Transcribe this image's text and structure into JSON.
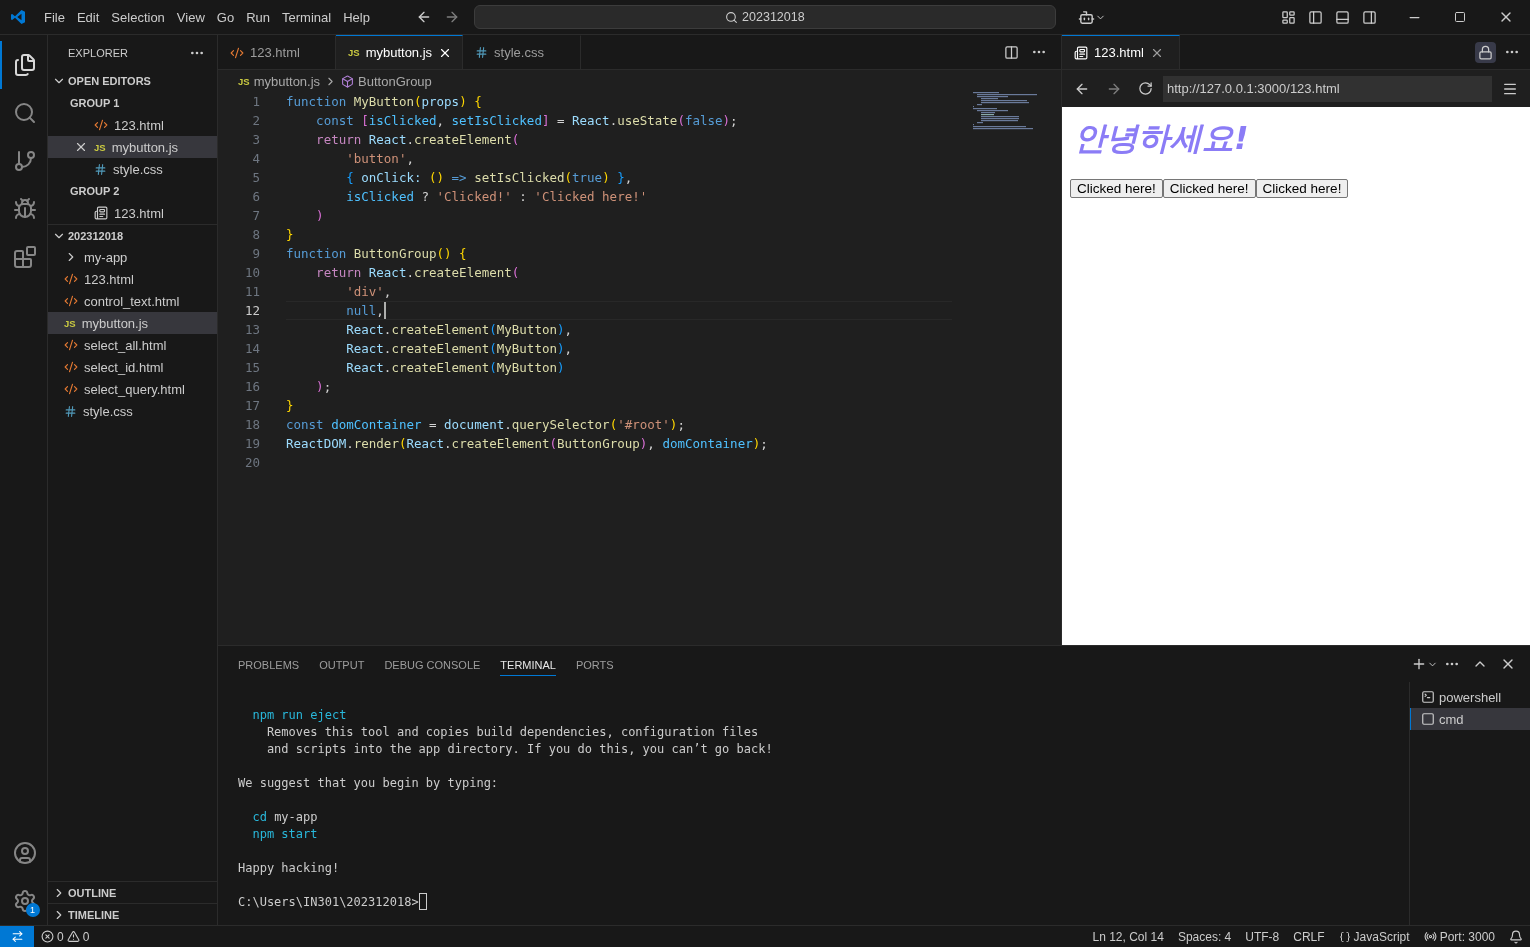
{
  "menu": [
    "File",
    "Edit",
    "Selection",
    "View",
    "Go",
    "Run",
    "Terminal",
    "Help"
  ],
  "command_center": "202312018",
  "sidebar": {
    "title": "EXPLORER",
    "open_editors": {
      "label": "OPEN EDITORS",
      "expanded": true,
      "groups": [
        {
          "label": "GROUP 1",
          "files": [
            {
              "name": "123.html",
              "kind": "html",
              "selected": false
            },
            {
              "name": "mybutton.js",
              "kind": "js",
              "badge": "JS",
              "selected": true
            },
            {
              "name": "style.css",
              "kind": "css",
              "selected": false
            }
          ]
        },
        {
          "label": "GROUP 2",
          "files": [
            {
              "name": "123.html",
              "kind": "preview",
              "selected": false
            }
          ]
        }
      ]
    },
    "folder": {
      "label": "202312018",
      "expanded": true,
      "items": [
        {
          "name": "my-app",
          "kind": "folder",
          "expanded": false,
          "selected": false
        },
        {
          "name": "123.html",
          "kind": "html",
          "selected": false
        },
        {
          "name": "control_text.html",
          "kind": "html",
          "selected": false
        },
        {
          "name": "mybutton.js",
          "kind": "js",
          "badge": "JS",
          "selected": true
        },
        {
          "name": "select_all.html",
          "kind": "html",
          "selected": false
        },
        {
          "name": "select_id.html",
          "kind": "html",
          "selected": false
        },
        {
          "name": "select_query.html",
          "kind": "html",
          "selected": false
        },
        {
          "name": "style.css",
          "kind": "css",
          "selected": false
        }
      ]
    },
    "sections": [
      {
        "label": "OUTLINE",
        "expanded": false
      },
      {
        "label": "TIMELINE",
        "expanded": false
      }
    ]
  },
  "settings_badge": "1",
  "editor": {
    "tabs": [
      {
        "name": "123.html",
        "kind": "html",
        "selected": false
      },
      {
        "name": "mybutton.js",
        "kind": "js",
        "badge": "JS",
        "selected": true
      },
      {
        "name": "style.css",
        "kind": "css",
        "selected": false
      }
    ],
    "breadcrumb": [
      {
        "text": "mybutton.js",
        "kind": "js",
        "badge": "JS"
      },
      {
        "text": "ButtonGroup",
        "kind": "symbol"
      }
    ],
    "lines": [
      {
        "n": "1",
        "current": false,
        "tokens": [
          {
            "t": "function ",
            "kind": "kw"
          },
          {
            "t": "MyButton",
            "kind": "fn"
          },
          {
            "t": "(",
            "kind": "b1"
          },
          {
            "t": "props",
            "kind": "var"
          },
          {
            "t": ") ",
            "kind": "b1"
          },
          {
            "t": "{",
            "kind": "b1"
          }
        ]
      },
      {
        "n": "2",
        "current": false,
        "tokens": [
          {
            "t": "    const ",
            "kind": "kw"
          },
          {
            "t": "[",
            "kind": "b2"
          },
          {
            "t": "isClicked",
            "kind": "const"
          },
          {
            "t": ", ",
            "kind": "plain"
          },
          {
            "t": "setIsClicked",
            "kind": "const"
          },
          {
            "t": "]",
            "kind": "b2"
          },
          {
            "t": " = ",
            "kind": "plain"
          },
          {
            "t": "React",
            "kind": "var"
          },
          {
            "t": ".",
            "kind": "plain"
          },
          {
            "t": "useState",
            "kind": "fn"
          },
          {
            "t": "(",
            "kind": "b2"
          },
          {
            "t": "false",
            "kind": "kw"
          },
          {
            "t": ")",
            "kind": "b2"
          },
          {
            "t": ";",
            "kind": "plain"
          }
        ]
      },
      {
        "n": "3",
        "current": false,
        "tokens": [
          {
            "t": "    return ",
            "kind": "ctl"
          },
          {
            "t": "React",
            "kind": "var"
          },
          {
            "t": ".",
            "kind": "plain"
          },
          {
            "t": "createElement",
            "kind": "fn"
          },
          {
            "t": "(",
            "kind": "b2"
          }
        ]
      },
      {
        "n": "4",
        "current": false,
        "tokens": [
          {
            "t": "        'button'",
            "kind": "str"
          },
          {
            "t": ",",
            "kind": "plain"
          }
        ]
      },
      {
        "n": "5",
        "current": false,
        "tokens": [
          {
            "t": "        {",
            "kind": "b3"
          },
          {
            "t": " onClick: ",
            "kind": "var"
          },
          {
            "t": "()",
            "kind": "b1"
          },
          {
            "t": " => ",
            "kind": "kw"
          },
          {
            "t": "setIsClicked",
            "kind": "fn"
          },
          {
            "t": "(",
            "kind": "b1"
          },
          {
            "t": "true",
            "kind": "kw"
          },
          {
            "t": ") ",
            "kind": "b1"
          },
          {
            "t": "}",
            "kind": "b3"
          },
          {
            "t": ",",
            "kind": "plain"
          }
        ]
      },
      {
        "n": "6",
        "current": false,
        "tokens": [
          {
            "t": "        isClicked",
            "kind": "const"
          },
          {
            "t": " ? ",
            "kind": "plain"
          },
          {
            "t": "'Clicked!'",
            "kind": "str"
          },
          {
            "t": " : ",
            "kind": "plain"
          },
          {
            "t": "'Clicked here!'",
            "kind": "str"
          }
        ]
      },
      {
        "n": "7",
        "current": false,
        "tokens": [
          {
            "t": "    )",
            "kind": "b2"
          }
        ]
      },
      {
        "n": "8",
        "current": false,
        "tokens": [
          {
            "t": "}",
            "kind": "b1"
          }
        ]
      },
      {
        "n": "9",
        "current": false,
        "tokens": [
          {
            "t": "function ",
            "kind": "kw"
          },
          {
            "t": "ButtonGroup",
            "kind": "fn"
          },
          {
            "t": "() ",
            "kind": "b1"
          },
          {
            "t": "{",
            "kind": "b1"
          }
        ]
      },
      {
        "n": "10",
        "current": false,
        "tokens": [
          {
            "t": "    return ",
            "kind": "ctl"
          },
          {
            "t": "React",
            "kind": "var"
          },
          {
            "t": ".",
            "kind": "plain"
          },
          {
            "t": "createElement",
            "kind": "fn"
          },
          {
            "t": "(",
            "kind": "b2"
          }
        ]
      },
      {
        "n": "11",
        "current": false,
        "tokens": [
          {
            "t": "        'div'",
            "kind": "str"
          },
          {
            "t": ",",
            "kind": "plain"
          }
        ]
      },
      {
        "n": "12",
        "current": true,
        "tokens": [
          {
            "t": "        null",
            "kind": "kw"
          },
          {
            "t": ",",
            "kind": "plain"
          }
        ]
      },
      {
        "n": "13",
        "current": false,
        "tokens": [
          {
            "t": "        React",
            "kind": "var"
          },
          {
            "t": ".",
            "kind": "plain"
          },
          {
            "t": "createElement",
            "kind": "fn"
          },
          {
            "t": "(",
            "kind": "b3"
          },
          {
            "t": "MyButton",
            "kind": "fn"
          },
          {
            "t": ")",
            "kind": "b3"
          },
          {
            "t": ",",
            "kind": "plain"
          }
        ]
      },
      {
        "n": "14",
        "current": false,
        "tokens": [
          {
            "t": "        React",
            "kind": "var"
          },
          {
            "t": ".",
            "kind": "plain"
          },
          {
            "t": "createElement",
            "kind": "fn"
          },
          {
            "t": "(",
            "kind": "b3"
          },
          {
            "t": "MyButton",
            "kind": "fn"
          },
          {
            "t": ")",
            "kind": "b3"
          },
          {
            "t": ",",
            "kind": "plain"
          }
        ]
      },
      {
        "n": "15",
        "current": false,
        "tokens": [
          {
            "t": "        React",
            "kind": "var"
          },
          {
            "t": ".",
            "kind": "plain"
          },
          {
            "t": "createElement",
            "kind": "fn"
          },
          {
            "t": "(",
            "kind": "b3"
          },
          {
            "t": "MyButton",
            "kind": "fn"
          },
          {
            "t": ")",
            "kind": "b3"
          }
        ]
      },
      {
        "n": "16",
        "current": false,
        "tokens": [
          {
            "t": "    )",
            "kind": "b2"
          },
          {
            "t": ";",
            "kind": "plain"
          }
        ]
      },
      {
        "n": "17",
        "current": false,
        "tokens": [
          {
            "t": "}",
            "kind": "b1"
          }
        ]
      },
      {
        "n": "18",
        "current": false,
        "tokens": [
          {
            "t": "const ",
            "kind": "kw"
          },
          {
            "t": "domContainer",
            "kind": "const"
          },
          {
            "t": " = ",
            "kind": "plain"
          },
          {
            "t": "document",
            "kind": "var"
          },
          {
            "t": ".",
            "kind": "plain"
          },
          {
            "t": "querySelector",
            "kind": "fn"
          },
          {
            "t": "(",
            "kind": "b1"
          },
          {
            "t": "'#root'",
            "kind": "str"
          },
          {
            "t": ")",
            "kind": "b1"
          },
          {
            "t": ";",
            "kind": "plain"
          }
        ]
      },
      {
        "n": "19",
        "current": false,
        "tokens": [
          {
            "t": "ReactDOM",
            "kind": "var"
          },
          {
            "t": ".",
            "kind": "plain"
          },
          {
            "t": "render",
            "kind": "fn"
          },
          {
            "t": "(",
            "kind": "b1"
          },
          {
            "t": "React",
            "kind": "var"
          },
          {
            "t": ".",
            "kind": "plain"
          },
          {
            "t": "createElement",
            "kind": "fn"
          },
          {
            "t": "(",
            "kind": "b2"
          },
          {
            "t": "ButtonGroup",
            "kind": "fn"
          },
          {
            "t": ")",
            "kind": "b2"
          },
          {
            "t": ", ",
            "kind": "plain"
          },
          {
            "t": "domContainer",
            "kind": "const"
          },
          {
            "t": ")",
            "kind": "b1"
          },
          {
            "t": ";",
            "kind": "plain"
          }
        ]
      },
      {
        "n": "20",
        "current": false
      }
    ]
  },
  "preview": {
    "tab": "123.html",
    "url": "http://127.0.0.1:3000/123.html",
    "heading": "안녕하세요!",
    "buttons": [
      "Clicked here!",
      "Clicked here!",
      "Clicked here!"
    ]
  },
  "panel": {
    "tabs": [
      {
        "label": "PROBLEMS",
        "selected": false
      },
      {
        "label": "OUTPUT",
        "selected": false
      },
      {
        "label": "DEBUG CONSOLE",
        "selected": false
      },
      {
        "label": "TERMINAL",
        "selected": true
      },
      {
        "label": "PORTS",
        "selected": false
      }
    ],
    "terminal_blocks": [
      {
        "lines": [
          {
            "segments": [
              {
                "t": "  npm run eject",
                "kind": "cmd"
              }
            ]
          },
          {
            "segments": [
              {
                "t": "    Removes this tool and copies build dependencies, configuration files",
                "kind": "plain"
              }
            ]
          },
          {
            "segments": [
              {
                "t": "    and scripts into the app directory. If you do this, you can’t go back!",
                "kind": "plain"
              }
            ]
          }
        ]
      },
      {
        "lines": [
          {
            "segments": [
              {
                "t": "We suggest that you begin by typing:",
                "kind": "plain"
              }
            ]
          }
        ]
      },
      {
        "lines": [
          {
            "segments": [
              {
                "t": "  cd",
                "kind": "cmd"
              },
              {
                "t": " my-app",
                "kind": "plain"
              }
            ]
          },
          {
            "segments": [
              {
                "t": "  npm start",
                "kind": "cmd"
              }
            ]
          }
        ]
      },
      {
        "lines": [
          {
            "segments": [
              {
                "t": "Happy hacking!",
                "kind": "plain"
              }
            ]
          }
        ]
      },
      {
        "lines": [
          {
            "segments": [
              {
                "t": "C:\\Users\\IN301\\202312018>",
                "kind": "plain"
              }
            ]
          }
        ]
      }
    ],
    "terminals": [
      {
        "name": "powershell",
        "kind": "powershell",
        "selected": false
      },
      {
        "name": "cmd",
        "kind": "cmd",
        "selected": true
      }
    ]
  },
  "status_bar": {
    "errors": "0",
    "warnings": "0",
    "position": "Ln 12, Col 14",
    "indent": "Spaces: 4",
    "encoding": "UTF-8",
    "eol": "CRLF",
    "language": "JavaScript",
    "port": "Port: 3000"
  }
}
